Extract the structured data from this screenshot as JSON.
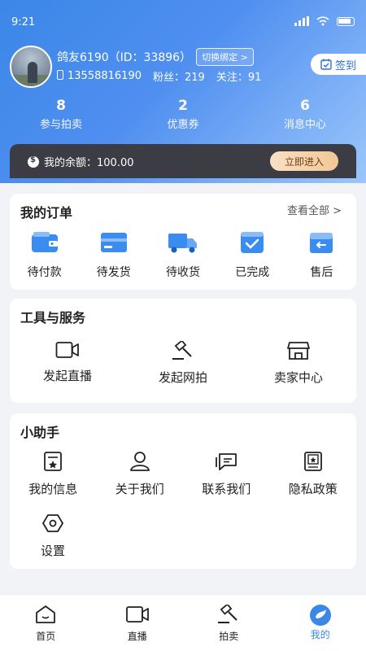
{
  "status_bar": {
    "time": "9:21"
  },
  "profile": {
    "nickname": "鸽友6190（ID：33896）",
    "switch_label": "切换绑定 >",
    "phone": "13558816190",
    "fans": "粉丝：219",
    "follow": "关注：91",
    "checkin_label": "签到"
  },
  "stats": [
    {
      "value": "8",
      "label": "参与拍卖"
    },
    {
      "value": "2",
      "label": "优惠券"
    },
    {
      "value": "6",
      "label": "消息中心"
    }
  ],
  "balance": {
    "label": "我的余额：100.00",
    "button": "立即进入"
  },
  "orders": {
    "title": "我的订单",
    "see_all": "查看全部 >",
    "items": [
      {
        "label": "待付款",
        "icon": "wallet-icon"
      },
      {
        "label": "待发货",
        "icon": "card-icon"
      },
      {
        "label": "待收货",
        "icon": "truck-icon"
      },
      {
        "label": "已完成",
        "icon": "check-box-icon"
      },
      {
        "label": "售后",
        "icon": "return-box-icon"
      }
    ]
  },
  "tools": {
    "title": "工具与服务",
    "items": [
      {
        "label": "发起直播",
        "icon": "video-camera-icon"
      },
      {
        "label": "发起网拍",
        "icon": "auction-hammer-icon"
      },
      {
        "label": "卖家中心",
        "icon": "store-icon"
      }
    ]
  },
  "helper": {
    "title": "小助手",
    "items": [
      {
        "label": "我的信息",
        "icon": "profile-card-icon"
      },
      {
        "label": "关于我们",
        "icon": "user-icon"
      },
      {
        "label": "联系我们",
        "icon": "chat-icon"
      },
      {
        "label": "隐私政策",
        "icon": "policy-book-icon"
      },
      {
        "label": "设置",
        "icon": "settings-hex-icon"
      }
    ]
  },
  "tabbar": [
    {
      "label": "首页",
      "icon": "home-icon"
    },
    {
      "label": "直播",
      "icon": "live-icon"
    },
    {
      "label": "拍卖",
      "icon": "hammer-icon"
    },
    {
      "label": "我的",
      "icon": "pigeon-icon",
      "active": true
    }
  ],
  "colors": {
    "accent": "#3b87e8",
    "balance_bg": "#3c3d44",
    "enter_btn": "#f2c796"
  }
}
